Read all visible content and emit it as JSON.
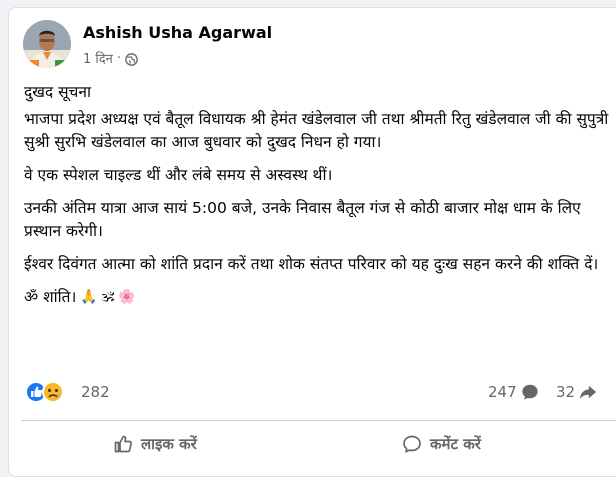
{
  "post": {
    "author": "Ashish Usha Agarwal",
    "time": "1 दिन",
    "separator": "·",
    "paragraphs": [
      "दुखद सूचना",
      "भाजपा प्रदेश अध्यक्ष एवं बैतूल विधायक श्री हेमंत खंडेलवाल जी तथा श्रीमती रितु खंडेलवाल जी की सुपुत्री सुश्री सुरभि खंडेलवाल का आज बुधवार को दुखद निधन हो गया।",
      "वे एक स्पेशल चाइल्ड थीं और लंबे समय से अस्वस्थ थीं।",
      "उनकी अंतिम यात्रा आज सायं 5:00 बजे, उनके निवास बैतूल गंज से कोठी बाजार मोक्ष धाम के लिए प्रस्थान करेगी।",
      "ईश्वर दिवंगत आत्मा को शांति प्रदान करें तथा शोक संतप्त परिवार को यह दुःख सहन करने की शक्ति दें।",
      "ॐ शांति।"
    ],
    "closing_emojis": [
      "🙏",
      "🕉",
      "🌸"
    ]
  },
  "stats": {
    "reactions": "282",
    "comments": "247",
    "shares": "32"
  },
  "actions": {
    "like_label": "लाइक करें",
    "comment_label": "कमेंट करें"
  },
  "colors": {
    "like_blue": "#1877f2",
    "sad_yellow": "#f7b928",
    "muted_text": "#65676b"
  },
  "icons": {
    "privacy": "globe-icon",
    "like": "thumbs-up-icon",
    "comment": "speech-bubble-icon",
    "share": "share-arrow-icon"
  }
}
